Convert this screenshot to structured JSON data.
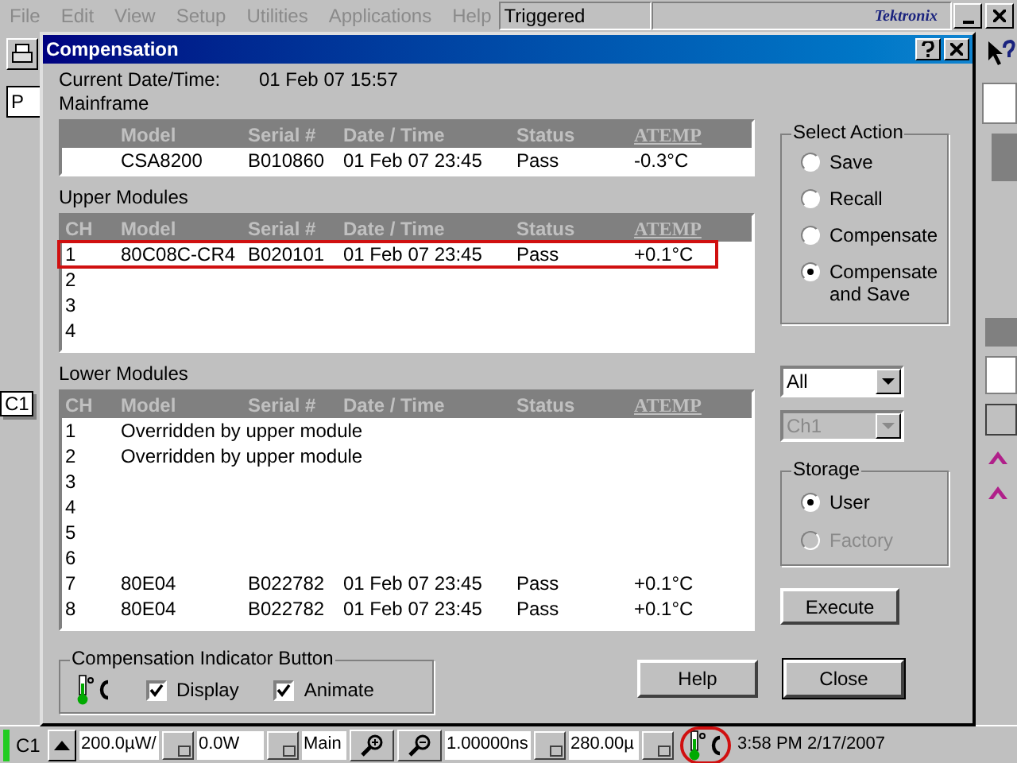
{
  "app": {
    "menu": [
      "File",
      "Edit",
      "View",
      "Setup",
      "Utilities",
      "Applications",
      "Help"
    ],
    "trigger_status": "Triggered",
    "logo": "Tektronix",
    "side_field": "P",
    "channel_marker": "C1"
  },
  "dialog": {
    "title": "Compensation",
    "datetime_label": "Current Date/Time:",
    "datetime": "01 Feb 07 15:57",
    "mainframe": {
      "label": "Mainframe",
      "columns": [
        "Model",
        "Serial #",
        "Date / Time",
        "Status",
        "ATEMP"
      ],
      "rows": [
        {
          "cells": [
            "CSA8200",
            "B010860",
            "01 Feb 07 23:45",
            "Pass",
            "-0.3°C"
          ],
          "highlighted": false
        }
      ]
    },
    "upper_modules": {
      "label": "Upper Modules",
      "columns": [
        "CH",
        "Model",
        "Serial #",
        "Date / Time",
        "Status",
        "ATEMP"
      ],
      "rows": [
        {
          "cells": [
            "1",
            "80C08C-CR4",
            "B020101",
            "01 Feb 07 23:45",
            "Pass",
            "+0.1°C"
          ],
          "highlighted": true
        },
        {
          "cells": [
            "2"
          ],
          "highlighted": false
        },
        {
          "cells": [
            "3"
          ],
          "highlighted": false
        },
        {
          "cells": [
            "4"
          ],
          "highlighted": false
        }
      ]
    },
    "lower_modules": {
      "label": "Lower Modules",
      "columns": [
        "CH",
        "Model",
        "Serial #",
        "Date / Time",
        "Status",
        "ATEMP"
      ],
      "rows": [
        {
          "cells": [
            "1",
            "Overridden by upper module"
          ],
          "highlighted": false
        },
        {
          "cells": [
            "2",
            "Overridden by upper module"
          ],
          "highlighted": false
        },
        {
          "cells": [
            "3"
          ],
          "highlighted": false
        },
        {
          "cells": [
            "4"
          ],
          "highlighted": false
        },
        {
          "cells": [
            "5"
          ],
          "highlighted": false
        },
        {
          "cells": [
            "6"
          ],
          "highlighted": false
        },
        {
          "cells": [
            "7",
            "80E04",
            "B022782",
            "01 Feb 07 23:45",
            "Pass",
            "+0.1°C"
          ],
          "highlighted": false
        },
        {
          "cells": [
            "8",
            "80E04",
            "B022782",
            "01 Feb 07 23:45",
            "Pass",
            "+0.1°C"
          ],
          "highlighted": false
        }
      ]
    },
    "select_action": {
      "label": "Select Action",
      "options": [
        {
          "label": "Save",
          "selected": false
        },
        {
          "label": "Recall",
          "selected": false
        },
        {
          "label": "Compensate",
          "selected": false
        },
        {
          "label": "Compensate and Save",
          "selected": true
        }
      ]
    },
    "channel_group": {
      "value": "All",
      "disabled": false
    },
    "channel": {
      "value": "Ch1",
      "disabled": true
    },
    "storage": {
      "label": "Storage",
      "options": [
        {
          "label": "User",
          "selected": true,
          "disabled": false
        },
        {
          "label": "Factory",
          "selected": false,
          "disabled": true
        }
      ]
    },
    "execute_button": "Execute",
    "indicator": {
      "label": "Compensation Indicator Button",
      "options": [
        {
          "label": "Display",
          "checked": true
        },
        {
          "label": "Animate",
          "checked": true
        }
      ]
    },
    "buttons": [
      {
        "label": "Help",
        "default": false
      },
      {
        "label": "Close",
        "default": true
      }
    ]
  },
  "status_bar": {
    "channel": "C1",
    "fields": [
      "200.0µW/",
      "0.0W"
    ],
    "view": "Main",
    "fields_right": [
      "1.00000ns",
      "280.00µ"
    ],
    "indicator_highlighted": true,
    "time": "3:58 PM 2/17/2007"
  }
}
